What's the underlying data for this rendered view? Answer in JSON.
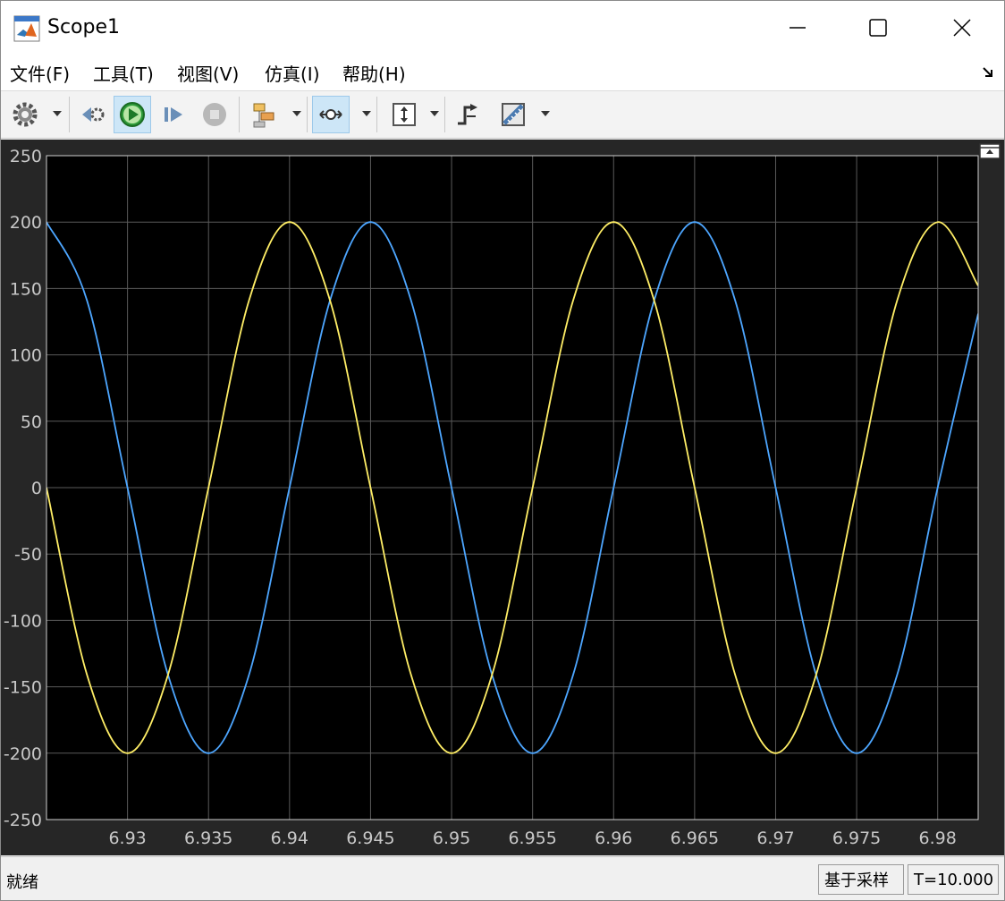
{
  "window": {
    "title": "Scope1",
    "controls": {
      "minimize": "minimize",
      "maximize": "maximize",
      "close": "close"
    }
  },
  "menu": {
    "items": [
      "文件(F)",
      "工具(T)",
      "视图(V)",
      "仿真(I)",
      "帮助(H)"
    ]
  },
  "toolbar": {
    "buttons": [
      "gear-icon",
      "step-back-icon",
      "run-icon",
      "step-forward-icon",
      "stop-icon",
      "signal-select-icon",
      "zoom-icon",
      "autoscale-icon",
      "trigger-icon",
      "measure-icon"
    ]
  },
  "status": {
    "left": "就绪",
    "mode": "基于采样",
    "time": "T=10.000"
  },
  "colors": {
    "plot_bg": "#000000",
    "figure_bg": "#262626",
    "grid": "#5a5a5a",
    "axis_text": "#c8c8c8",
    "series1": "#4da6ff",
    "series2": "#ffee66"
  },
  "chart_data": {
    "type": "line",
    "title": "",
    "xlabel": "",
    "ylabel": "",
    "xlim": [
      6.925,
      6.9825
    ],
    "ylim": [
      -250,
      250
    ],
    "xticks": [
      "6.93",
      "6.935",
      "6.94",
      "6.945",
      "6.95",
      "6.955",
      "6.96",
      "6.965",
      "6.97",
      "6.975",
      "6.98"
    ],
    "xtick_values": [
      6.93,
      6.935,
      6.94,
      6.945,
      6.95,
      6.955,
      6.96,
      6.965,
      6.97,
      6.975,
      6.98
    ],
    "yticks": [
      "250",
      "200",
      "150",
      "100",
      "50",
      "0",
      "-50",
      "-100",
      "-150",
      "-200",
      "-250"
    ],
    "ytick_values": [
      250,
      200,
      150,
      100,
      50,
      0,
      -50,
      -100,
      -150,
      -200,
      -250
    ],
    "grid": true,
    "series": [
      {
        "color": "#4da6ff",
        "x": [
          6.925,
          6.9275,
          6.93,
          6.9325,
          6.935,
          6.9375,
          6.94,
          6.9425,
          6.945,
          6.9475,
          6.95,
          6.9525,
          6.955,
          6.9575,
          6.96,
          6.9625,
          6.965,
          6.9675,
          6.97,
          6.9725,
          6.975,
          6.9775,
          6.98,
          6.9825
        ],
        "y": [
          200,
          141,
          0,
          -141,
          -200,
          -141,
          0,
          141,
          200,
          141,
          0,
          -141,
          -200,
          -141,
          0,
          141,
          200,
          141,
          0,
          -141,
          -200,
          -141,
          0,
          131
        ]
      },
      {
        "color": "#ffee66",
        "x": [
          6.925,
          6.9275,
          6.93,
          6.9325,
          6.935,
          6.9375,
          6.94,
          6.9425,
          6.945,
          6.9475,
          6.95,
          6.9525,
          6.955,
          6.9575,
          6.96,
          6.9625,
          6.965,
          6.9675,
          6.97,
          6.9725,
          6.975,
          6.9775,
          6.98,
          6.9825
        ],
        "y": [
          0,
          -141,
          -200,
          -141,
          0,
          141,
          200,
          141,
          0,
          -141,
          -200,
          -141,
          0,
          141,
          200,
          141,
          0,
          -141,
          -200,
          -141,
          0,
          141,
          200,
          152
        ]
      }
    ]
  }
}
